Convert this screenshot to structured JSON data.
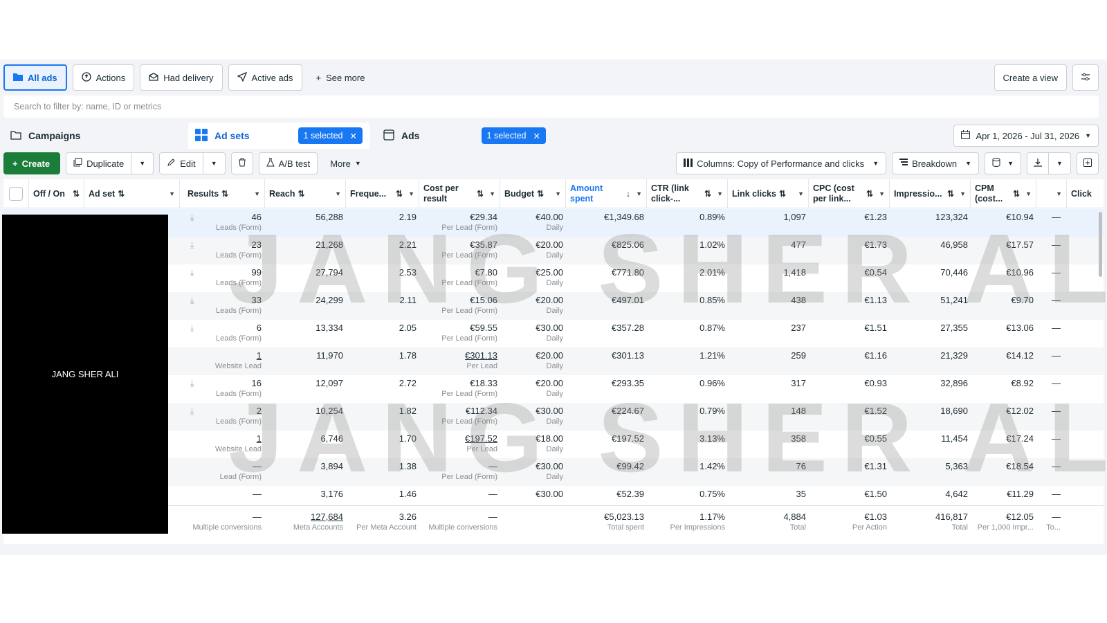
{
  "views": {
    "all_ads": "All ads",
    "actions": "Actions",
    "had_delivery": "Had delivery",
    "active_ads": "Active ads",
    "see_more": "See more",
    "create_view": "Create a view"
  },
  "search": {
    "placeholder": "Search to filter by: name, ID or metrics"
  },
  "levels": {
    "campaigns": "Campaigns",
    "ad_sets": "Ad sets",
    "ad_sets_selected": "1 selected",
    "ads": "Ads",
    "ads_selected": "1 selected",
    "date_range": "Apr 1, 2026 - Jul 31, 2026"
  },
  "toolbar": {
    "create": "Create",
    "duplicate": "Duplicate",
    "edit": "Edit",
    "ab_test": "A/B test",
    "more": "More",
    "columns": "Columns: Copy of Performance and clicks",
    "breakdown": "Breakdown"
  },
  "columns": {
    "off_on": "Off / On",
    "ad_set": "Ad set",
    "results": "Results",
    "reach": "Reach",
    "frequency": "Freque...",
    "cost_per_result": "Cost per result",
    "budget": "Budget",
    "amount_spent": "Amount spent",
    "ctr": "CTR (link click-...",
    "link_clicks": "Link clicks",
    "cpc": "CPC (cost per link...",
    "impressions": "Impressio...",
    "cpm": "CPM (cost...",
    "clicks": "Click"
  },
  "rows": [
    {
      "results": "46",
      "results_sub": "Leads (Form)",
      "reach": "56,288",
      "freq": "2.19",
      "cpr": "€29.34",
      "cpr_sub": "Per Lead (Form)",
      "budget": "€40.00",
      "budget_sub": "Daily",
      "spent": "€1,349.68",
      "ctr": "0.89%",
      "clicks": "1,097",
      "cpc": "€1.23",
      "impr": "123,324",
      "cpm": "€10.94",
      "dash": "—"
    },
    {
      "results": "23",
      "results_sub": "Leads (Form)",
      "reach": "21,268",
      "freq": "2.21",
      "cpr": "€35.87",
      "cpr_sub": "Per Lead (Form)",
      "budget": "€20.00",
      "budget_sub": "Daily",
      "spent": "€825.06",
      "ctr": "1.02%",
      "clicks": "477",
      "cpc": "€1.73",
      "impr": "46,958",
      "cpm": "€17.57",
      "dash": "—"
    },
    {
      "results": "99",
      "results_sub": "Leads (Form)",
      "reach": "27,794",
      "freq": "2.53",
      "cpr": "€7.80",
      "cpr_sub": "Per Lead (Form)",
      "budget": "€25.00",
      "budget_sub": "Daily",
      "spent": "€771.80",
      "ctr": "2.01%",
      "clicks": "1,418",
      "cpc": "€0.54",
      "impr": "70,446",
      "cpm": "€10.96",
      "dash": "—"
    },
    {
      "results": "33",
      "results_sub": "Leads (Form)",
      "reach": "24,299",
      "freq": "2.11",
      "cpr": "€15.06",
      "cpr_sub": "Per Lead (Form)",
      "budget": "€20.00",
      "budget_sub": "Daily",
      "spent": "€497.01",
      "ctr": "0.85%",
      "clicks": "438",
      "cpc": "€1.13",
      "impr": "51,241",
      "cpm": "€9.70",
      "dash": "—"
    },
    {
      "results": "6",
      "results_sub": "Leads (Form)",
      "reach": "13,334",
      "freq": "2.05",
      "cpr": "€59.55",
      "cpr_sub": "Per Lead (Form)",
      "budget": "€30.00",
      "budget_sub": "Daily",
      "spent": "€357.28",
      "ctr": "0.87%",
      "clicks": "237",
      "cpc": "€1.51",
      "impr": "27,355",
      "cpm": "€13.06",
      "dash": "—"
    },
    {
      "results": "1",
      "results_sub": "Website Lead",
      "reach": "11,970",
      "freq": "1.78",
      "cpr": "€301.13",
      "cpr_sub": "Per Lead",
      "budget": "€20.00",
      "budget_sub": "Daily",
      "spent": "€301.13",
      "ctr": "1.21%",
      "clicks": "259",
      "cpc": "€1.16",
      "impr": "21,329",
      "cpm": "€14.12",
      "dash": "—",
      "underline": true
    },
    {
      "results": "16",
      "results_sub": "Leads (Form)",
      "reach": "12,097",
      "freq": "2.72",
      "cpr": "€18.33",
      "cpr_sub": "Per Lead (Form)",
      "budget": "€20.00",
      "budget_sub": "Daily",
      "spent": "€293.35",
      "ctr": "0.96%",
      "clicks": "317",
      "cpc": "€0.93",
      "impr": "32,896",
      "cpm": "€8.92",
      "dash": "—"
    },
    {
      "results": "2",
      "results_sub": "Leads (Form)",
      "reach": "10,254",
      "freq": "1.82",
      "cpr": "€112.34",
      "cpr_sub": "Per Lead (Form)",
      "budget": "€30.00",
      "budget_sub": "Daily",
      "spent": "€224.67",
      "ctr": "0.79%",
      "clicks": "148",
      "cpc": "€1.52",
      "impr": "18,690",
      "cpm": "€12.02",
      "dash": "—"
    },
    {
      "results": "1",
      "results_sub": "Website Lead",
      "reach": "6,746",
      "freq": "1.70",
      "cpr": "€197.52",
      "cpr_sub": "Per Lead",
      "budget": "€18.00",
      "budget_sub": "Daily",
      "spent": "€197.52",
      "ctr": "3.13%",
      "clicks": "358",
      "cpc": "€0.55",
      "impr": "11,454",
      "cpm": "€17.24",
      "dash": "—",
      "underline": true
    },
    {
      "results": "—",
      "results_sub": "Lead (Form)",
      "reach": "3,894",
      "freq": "1.38",
      "cpr": "—",
      "cpr_sub": "Per Lead (Form)",
      "budget": "€30.00",
      "budget_sub": "Daily",
      "spent": "€99.42",
      "ctr": "1.42%",
      "clicks": "76",
      "cpc": "€1.31",
      "impr": "5,363",
      "cpm": "€18.54",
      "dash": "—"
    },
    {
      "results": "—",
      "results_sub": "",
      "reach": "3,176",
      "freq": "1.46",
      "cpr": "—",
      "cpr_sub": "",
      "budget": "€30.00",
      "budget_sub": "",
      "spent": "€52.39",
      "ctr": "0.75%",
      "clicks": "35",
      "cpc": "€1.50",
      "impr": "4,642",
      "cpm": "€11.29",
      "dash": "—"
    }
  ],
  "totals": {
    "results": "—",
    "results_sub": "Multiple conversions",
    "reach": "127,684",
    "reach_sub": "Meta Accounts",
    "freq": "3.26",
    "freq_sub": "Per Meta Account",
    "cpr": "—",
    "cpr_sub": "Multiple conversions",
    "spent": "€5,023.13",
    "spent_sub": "Total spent",
    "ctr": "1.17%",
    "ctr_sub": "Per Impressions",
    "clicks": "4,884",
    "clicks_sub": "Total",
    "cpc": "€1.03",
    "cpc_sub": "Per Action",
    "impr": "416,817",
    "impr_sub": "Total",
    "cpm": "€12.05",
    "cpm_sub": "Per 1,000 Impr...",
    "dash": "—",
    "dash_sub": "To..."
  },
  "redaction_label": "JANG SHER ALI",
  "watermark": "JANG SHER ALI"
}
